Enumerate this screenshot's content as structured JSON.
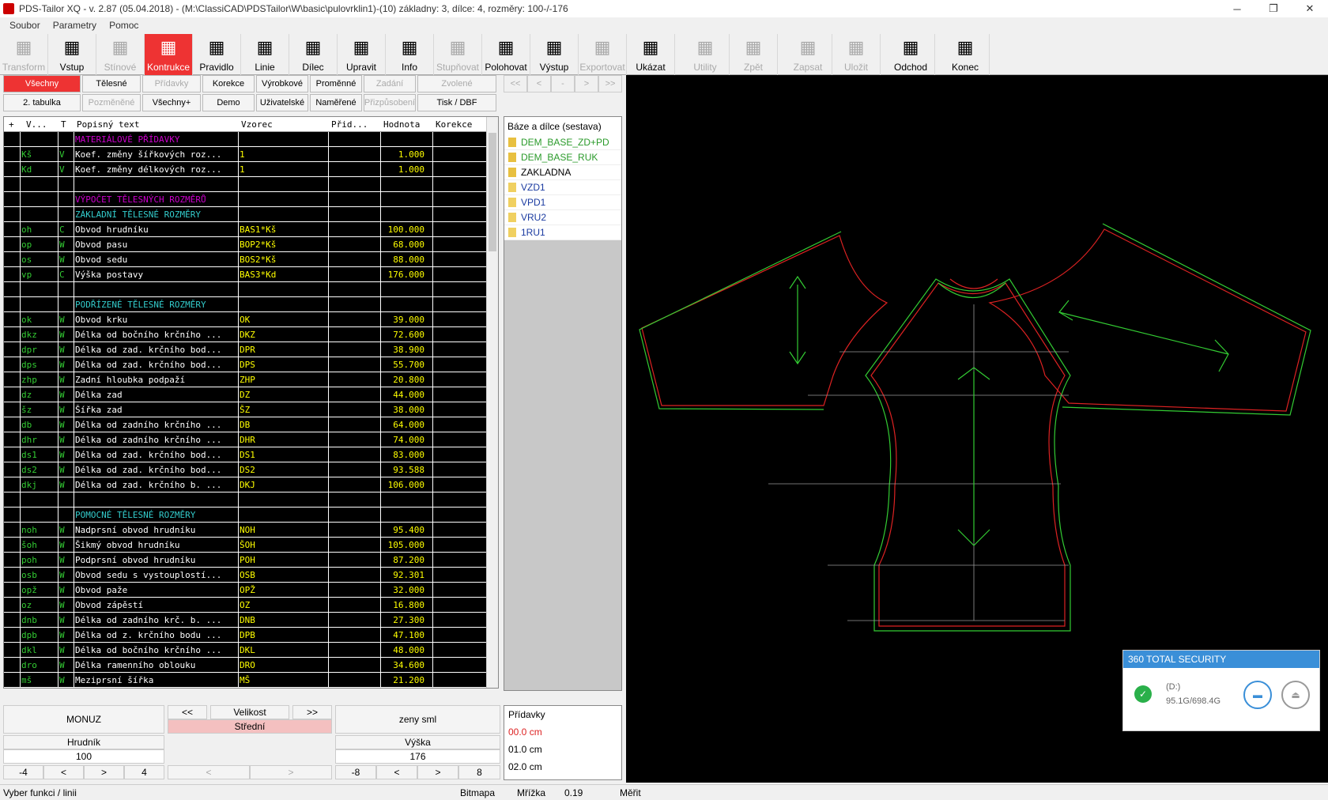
{
  "window": {
    "title": "PDS-Tailor XQ - v. 2.87 (05.04.2018) - (M:\\ClassiCAD\\PDSTailor\\W\\basic\\pulovrklin1)-(10) základny: 3, dílce: 4, rozměry: 100-/-176"
  },
  "menu": [
    "Soubor",
    "Parametry",
    "Pomoc"
  ],
  "toolbar": [
    {
      "label": "Transform",
      "state": "disabled"
    },
    {
      "label": "Vstup",
      "state": "normal"
    },
    {
      "label": "Stínové",
      "state": "disabled"
    },
    {
      "label": "Kontrukce",
      "state": "active"
    },
    {
      "label": "Pravidlo",
      "state": "normal"
    },
    {
      "label": "Linie",
      "state": "normal"
    },
    {
      "label": "Dílec",
      "state": "normal"
    },
    {
      "label": "Upravit",
      "state": "normal"
    },
    {
      "label": "Info",
      "state": "normal"
    },
    {
      "label": "Stupňovat",
      "state": "disabled"
    },
    {
      "label": "Polohovat",
      "state": "normal"
    },
    {
      "label": "Výstup",
      "state": "normal"
    },
    {
      "label": "Exportovat",
      "state": "disabled"
    },
    {
      "label": "Ukázat",
      "state": "normal"
    },
    {
      "label": "Utility",
      "state": "disabled"
    },
    {
      "label": "Zpět",
      "state": "disabled"
    },
    {
      "label": "Zapsat",
      "state": "disabled"
    },
    {
      "label": "Uložit",
      "state": "disabled"
    },
    {
      "label": "Odchod",
      "state": "normal"
    },
    {
      "label": "Konec",
      "state": "normal"
    }
  ],
  "tabs_row1": [
    "Všechny",
    "Tělesné",
    "Přídavky",
    "Korekce",
    "Výrobkové",
    "Proměnné",
    "Zadání",
    "Zvolené"
  ],
  "tabs_row2": [
    "2. tabulka",
    "Pozměněné",
    "Všechny+",
    "Demo",
    "Uživatelské",
    "Naměřené",
    "Přizpůsobení",
    "Tisk / DBF"
  ],
  "grid_headers": [
    "+",
    "V...",
    "T",
    "Popisný text",
    "Vzorec",
    "Přid...",
    "Hodnota",
    "Korekce"
  ],
  "grid_rows": [
    {
      "id": "",
      "t": "",
      "text": "MATERIÁLOVÉ PŘÍDAVKY",
      "formula": "",
      "value": "",
      "kind": "sec"
    },
    {
      "id": "Kš",
      "t": "V",
      "text": "Koef. změny šířkových roz...",
      "formula": "1",
      "value": "1.000",
      "kind": ""
    },
    {
      "id": "Kd",
      "t": "V",
      "text": "Koef. změny délkových roz...",
      "formula": "1",
      "value": "1.000",
      "kind": ""
    },
    {
      "id": "",
      "t": "",
      "text": "",
      "formula": "",
      "value": "",
      "kind": ""
    },
    {
      "id": "",
      "t": "",
      "text": "VÝPOČET TĚLESNÝCH ROZMĚRŮ",
      "formula": "",
      "value": "",
      "kind": "sec"
    },
    {
      "id": "",
      "t": "",
      "text": "ZÁKLADNÍ TĚLESNÉ ROZMĚRY",
      "formula": "",
      "value": "",
      "kind": "sec2"
    },
    {
      "id": "oh",
      "t": "C",
      "text": "Obvod hrudníku",
      "formula": "BAS1*Kš",
      "value": "100.000",
      "kind": ""
    },
    {
      "id": "op",
      "t": "W",
      "text": "Obvod pasu",
      "formula": "BOP2*Kš",
      "value": "68.000",
      "kind": ""
    },
    {
      "id": "os",
      "t": "W",
      "text": "Obvod sedu",
      "formula": "BOS2*Kš",
      "value": "88.000",
      "kind": ""
    },
    {
      "id": "vp",
      "t": "C",
      "text": "Výška postavy",
      "formula": "BAS3*Kd",
      "value": "176.000",
      "kind": ""
    },
    {
      "id": "",
      "t": "",
      "text": "",
      "formula": "",
      "value": "",
      "kind": ""
    },
    {
      "id": "",
      "t": "",
      "text": "PODŘÍZENÉ TĚLESNÉ ROZMĚRY",
      "formula": "",
      "value": "",
      "kind": "sec2"
    },
    {
      "id": "ok",
      "t": "W",
      "text": "Obvod krku",
      "formula": "OK",
      "value": "39.000",
      "kind": ""
    },
    {
      "id": "dkz",
      "t": "W",
      "text": "Délka od bočního krčního ...",
      "formula": "DKZ",
      "value": "72.600",
      "kind": ""
    },
    {
      "id": "dpr",
      "t": "W",
      "text": "Délka od zad. krčního bod...",
      "formula": "DPR",
      "value": "38.900",
      "kind": ""
    },
    {
      "id": "dps",
      "t": "W",
      "text": "Délka od zad. krčního bod...",
      "formula": "DPS",
      "value": "55.700",
      "kind": ""
    },
    {
      "id": "zhp",
      "t": "W",
      "text": "Zadní hloubka podpaží",
      "formula": "ZHP",
      "value": "20.800",
      "kind": ""
    },
    {
      "id": "dz",
      "t": "W",
      "text": "Délka zad",
      "formula": "DZ",
      "value": "44.000",
      "kind": ""
    },
    {
      "id": "šz",
      "t": "W",
      "text": "Šířka zad",
      "formula": "ŠZ",
      "value": "38.000",
      "kind": ""
    },
    {
      "id": "db",
      "t": "W",
      "text": "Délka od zadního krčního ...",
      "formula": "DB",
      "value": "64.000",
      "kind": ""
    },
    {
      "id": "dhr",
      "t": "W",
      "text": "Délka od zadního krčního ...",
      "formula": "DHR",
      "value": "74.000",
      "kind": ""
    },
    {
      "id": "ds1",
      "t": "W",
      "text": "Délka od zad. krčního bod...",
      "formula": "DS1",
      "value": "83.000",
      "kind": ""
    },
    {
      "id": "ds2",
      "t": "W",
      "text": "Délka od zad. krčního bod...",
      "formula": "DS2",
      "value": "93.588",
      "kind": ""
    },
    {
      "id": "dkj",
      "t": "W",
      "text": "Délka od zad. krčního b. ...",
      "formula": "DKJ",
      "value": "106.000",
      "kind": ""
    },
    {
      "id": "",
      "t": "",
      "text": "",
      "formula": "",
      "value": "",
      "kind": ""
    },
    {
      "id": "",
      "t": "",
      "text": "POMOCNÉ TĚLESNÉ ROZMĚRY",
      "formula": "",
      "value": "",
      "kind": "sec2"
    },
    {
      "id": "noh",
      "t": "W",
      "text": "Nadprsní obvod hrudníku",
      "formula": "NOH",
      "value": "95.400",
      "kind": ""
    },
    {
      "id": "šoh",
      "t": "W",
      "text": "Šikmý obvod hrudníku",
      "formula": "ŠOH",
      "value": "105.000",
      "kind": ""
    },
    {
      "id": "poh",
      "t": "W",
      "text": "Podprsní obvod hrudníku",
      "formula": "POH",
      "value": "87.200",
      "kind": ""
    },
    {
      "id": "osb",
      "t": "W",
      "text": "Obvod sedu s vystouplostí...",
      "formula": "OSB",
      "value": "92.301",
      "kind": ""
    },
    {
      "id": "opž",
      "t": "W",
      "text": "Obvod paže",
      "formula": "OPŽ",
      "value": "32.000",
      "kind": ""
    },
    {
      "id": "oz",
      "t": "W",
      "text": "Obvod zápěstí",
      "formula": "OZ",
      "value": "16.800",
      "kind": ""
    },
    {
      "id": "dnb",
      "t": "W",
      "text": "Délka od zadního krč. b. ...",
      "formula": "DNB",
      "value": "27.300",
      "kind": ""
    },
    {
      "id": "dpb",
      "t": "W",
      "text": "Délka od z. krčního bodu ...",
      "formula": "DPB",
      "value": "47.100",
      "kind": ""
    },
    {
      "id": "dkl",
      "t": "W",
      "text": "Délka od bočního krčního ...",
      "formula": "DKL",
      "value": "48.000",
      "kind": ""
    },
    {
      "id": "dro",
      "t": "W",
      "text": "Délka ramenního oblouku",
      "formula": "DRO",
      "value": "34.600",
      "kind": ""
    },
    {
      "id": "mš",
      "t": "W",
      "text": "Meziprsní šířka",
      "formula": "MŠ",
      "value": "21.200",
      "kind": ""
    }
  ],
  "nav": [
    "<<",
    "<",
    "-",
    ">",
    ">>"
  ],
  "parts": {
    "header": "Báze a dílce (sestava)",
    "items": [
      {
        "label": "DEM_BASE_ZD+PD",
        "color": "#2a9a2a"
      },
      {
        "label": "DEM_BASE_RUK",
        "color": "#2a9a2a"
      },
      {
        "label": "ZAKLADNA",
        "color": "#000000"
      },
      {
        "label": "VZD1",
        "color": "#1a3aa0"
      },
      {
        "label": "VPD1",
        "color": "#1a3aa0"
      },
      {
        "label": "VRU2",
        "color": "#1a3aa0"
      },
      {
        "label": "1RU1",
        "color": "#1a3aa0"
      }
    ]
  },
  "bottom": {
    "model": "MONUZ",
    "size_prev": "<<",
    "size_label": "Velikost",
    "size_next": ">>",
    "size_value": "Střední",
    "group": "zeny sml",
    "chest_label": "Hrudník",
    "chest_value": "100",
    "height_label": "Výška",
    "height_value": "176",
    "chest_min": "-4",
    "chest_max": "4",
    "height_min": "-8",
    "height_max": "8",
    "prev": "<",
    "next": ">"
  },
  "pridavky": {
    "header": "Přídavky",
    "items": [
      "00.0 cm",
      "01.0 cm",
      "02.0 cm"
    ]
  },
  "status": {
    "text": "Vyber funkci / linii",
    "bitmap": "Bitmapa",
    "grid": "Mřížka",
    "grid_val": "0.19",
    "measure": "Měřit"
  },
  "security": {
    "title": "360 TOTAL SECURITY",
    "drive": "(D:)",
    "space": "95.1G/698.4G"
  }
}
